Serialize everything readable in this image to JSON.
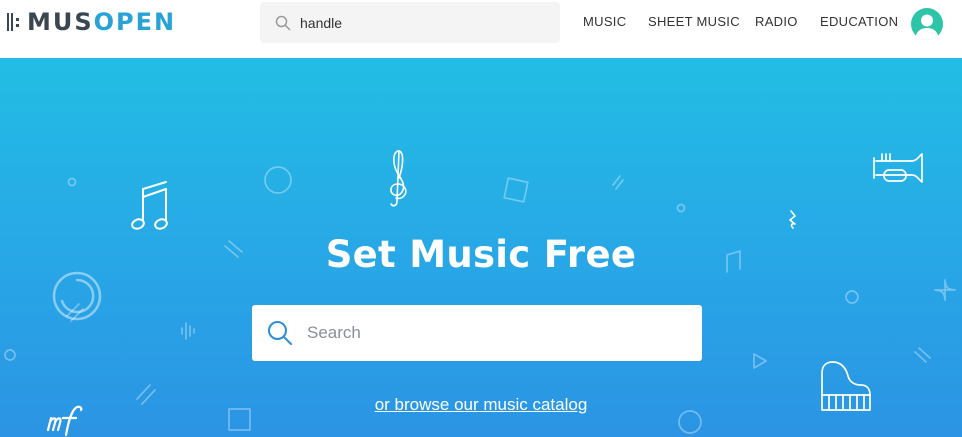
{
  "header": {
    "logo": {
      "part1": "MUS",
      "part2": "OPEN"
    },
    "search": {
      "value": "handle",
      "icon": "search-icon"
    },
    "nav": [
      {
        "label": "MUSIC"
      },
      {
        "label": "SHEET MUSIC"
      },
      {
        "label": "RADIO"
      },
      {
        "label": "EDUCATION"
      }
    ],
    "avatar": {
      "icon": "user-avatar-icon",
      "color": "#2ec4a8"
    }
  },
  "hero": {
    "title": "Set Music Free",
    "search": {
      "placeholder": "Search",
      "icon": "search-icon",
      "icon_color": "#2b8ed6"
    },
    "browse_link": "or browse our music catalog",
    "gradient": [
      "#22bde4",
      "#2b94e4"
    ],
    "decorations": [
      "music-note-icon",
      "treble-clef-icon",
      "trumpet-icon",
      "quarter-rest-icon",
      "piano-icon",
      "mezzo-forte-icon",
      "vinyl-icon",
      "sparkle-icon"
    ]
  }
}
